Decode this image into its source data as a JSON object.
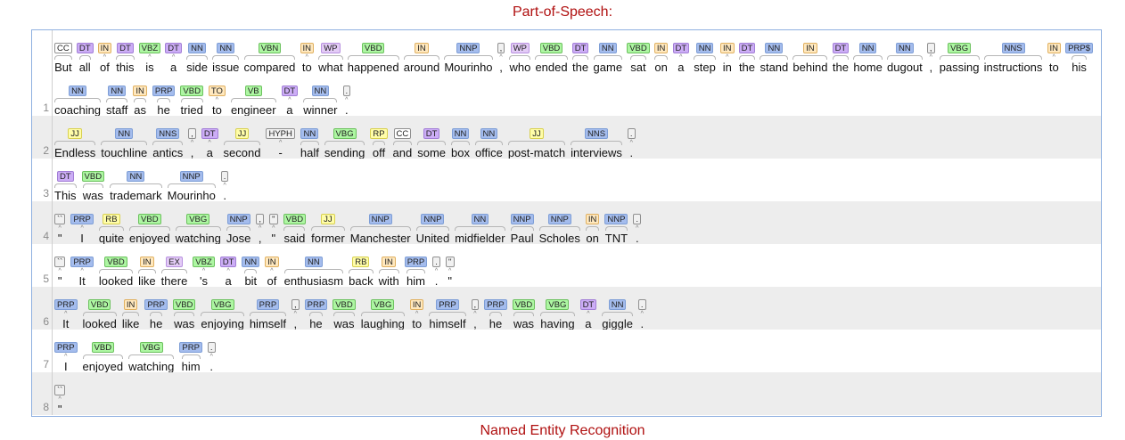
{
  "section_title": "Part-of-Speech:",
  "next_section_title": "Named Entity Recognition",
  "tag_colors": {
    "blue": {
      "bg": "#a4bced",
      "bd": "#7e9ed6"
    },
    "green": {
      "bg": "#adf6a2",
      "bd": "#6cc15e"
    },
    "purple": {
      "bg": "#ccadf6",
      "bd": "#a27ed6"
    },
    "orange": {
      "bg": "#ffe8be",
      "bd": "#e0b060"
    },
    "yellow": {
      "bg": "#fffda8",
      "bd": "#d8d050"
    },
    "pink": {
      "bg": "#e3cbf6",
      "bd": "#b891e0"
    },
    "white": {
      "bg": "#ffffff",
      "bd": "#909090"
    },
    "gray": {
      "bg": "#f1f1f1",
      "bd": "#909090"
    }
  },
  "sentences": [
    {
      "number": "1",
      "rows": [
        [
          [
            "But",
            "CC"
          ],
          [
            "all",
            "DT"
          ],
          [
            "of",
            "IN"
          ],
          [
            "this",
            "DT"
          ],
          [
            "is",
            "VBZ"
          ],
          [
            "a",
            "DT"
          ],
          [
            "side",
            "NN"
          ],
          [
            "issue",
            "NN"
          ],
          [
            "compared",
            "VBN"
          ],
          [
            "to",
            "IN"
          ],
          [
            "what",
            "WP"
          ],
          [
            "happened",
            "VBD"
          ],
          [
            "around",
            "IN"
          ],
          [
            "Mourinho",
            "NNP"
          ],
          [
            ",",
            ","
          ],
          [
            "who",
            "WP"
          ],
          [
            "ended",
            "VBD"
          ],
          [
            "the",
            "DT"
          ],
          [
            "game",
            "NN"
          ],
          [
            "sat",
            "VBD"
          ],
          [
            "on",
            "IN"
          ],
          [
            "a",
            "DT"
          ],
          [
            "step",
            "NN"
          ],
          [
            "in",
            "IN"
          ],
          [
            "the",
            "DT"
          ],
          [
            "stand",
            "NN"
          ],
          [
            "behind",
            "IN"
          ],
          [
            "the",
            "DT"
          ],
          [
            "home",
            "NN"
          ],
          [
            "dugout",
            "NN"
          ],
          [
            ",",
            ","
          ],
          [
            "passing",
            "VBG"
          ],
          [
            "instructions",
            "NNS"
          ],
          [
            "to",
            "IN"
          ],
          [
            "his",
            "PRP$"
          ]
        ],
        [
          [
            "coaching",
            "NN"
          ],
          [
            "staff",
            "NN"
          ],
          [
            "as",
            "IN"
          ],
          [
            "he",
            "PRP"
          ],
          [
            "tried",
            "VBD"
          ],
          [
            "to",
            "TO"
          ],
          [
            "engineer",
            "VB"
          ],
          [
            "a",
            "DT"
          ],
          [
            "winner",
            "NN"
          ],
          [
            ".",
            "."
          ]
        ]
      ]
    },
    {
      "number": "2",
      "rows": [
        [
          [
            "Endless",
            "JJ"
          ],
          [
            "touchline",
            "NN"
          ],
          [
            "antics",
            "NNS"
          ],
          [
            ",",
            ","
          ],
          [
            "a",
            "DT"
          ],
          [
            "second",
            "JJ"
          ],
          [
            "-",
            "HYPH"
          ],
          [
            "half",
            "NN"
          ],
          [
            "sending",
            "VBG"
          ],
          [
            "off",
            "RP"
          ],
          [
            "and",
            "CC"
          ],
          [
            "some",
            "DT"
          ],
          [
            "box",
            "NN"
          ],
          [
            "office",
            "NN"
          ],
          [
            "post-match",
            "JJ"
          ],
          [
            "interviews",
            "NNS"
          ],
          [
            ".",
            "."
          ]
        ]
      ]
    },
    {
      "number": "3",
      "rows": [
        [
          [
            "This",
            "DT"
          ],
          [
            "was",
            "VBD"
          ],
          [
            "trademark",
            "NN"
          ],
          [
            "Mourinho",
            "NNP"
          ],
          [
            ".",
            "."
          ]
        ]
      ]
    },
    {
      "number": "4",
      "rows": [
        [
          [
            "\"",
            "``"
          ],
          [
            "I",
            "PRP"
          ],
          [
            "quite",
            "RB"
          ],
          [
            "enjoyed",
            "VBD"
          ],
          [
            "watching",
            "VBG"
          ],
          [
            "Jose",
            "NNP"
          ],
          [
            ",",
            ","
          ],
          [
            "\"",
            "''"
          ],
          [
            "said",
            "VBD"
          ],
          [
            "former",
            "JJ"
          ],
          [
            "Manchester",
            "NNP"
          ],
          [
            "United",
            "NNP"
          ],
          [
            "midfielder",
            "NN"
          ],
          [
            "Paul",
            "NNP"
          ],
          [
            "Scholes",
            "NNP"
          ],
          [
            "on",
            "IN"
          ],
          [
            "TNT",
            "NNP"
          ],
          [
            ".",
            "."
          ]
        ]
      ]
    },
    {
      "number": "5",
      "rows": [
        [
          [
            "\"",
            "``"
          ],
          [
            "It",
            "PRP"
          ],
          [
            "looked",
            "VBD"
          ],
          [
            "like",
            "IN"
          ],
          [
            "there",
            "EX"
          ],
          [
            "'s",
            "VBZ"
          ],
          [
            "a",
            "DT"
          ],
          [
            "bit",
            "NN"
          ],
          [
            "of",
            "IN"
          ],
          [
            "enthusiasm",
            "NN"
          ],
          [
            "back",
            "RB"
          ],
          [
            "with",
            "IN"
          ],
          [
            "him",
            "PRP"
          ],
          [
            ".",
            "."
          ],
          [
            "\"",
            "''"
          ]
        ]
      ]
    },
    {
      "number": "6",
      "rows": [
        [
          [
            "It",
            "PRP"
          ],
          [
            "looked",
            "VBD"
          ],
          [
            "like",
            "IN"
          ],
          [
            "he",
            "PRP"
          ],
          [
            "was",
            "VBD"
          ],
          [
            "enjoying",
            "VBG"
          ],
          [
            "himself",
            "PRP"
          ],
          [
            ",",
            ","
          ],
          [
            "he",
            "PRP"
          ],
          [
            "was",
            "VBD"
          ],
          [
            "laughing",
            "VBG"
          ],
          [
            "to",
            "IN"
          ],
          [
            "himself",
            "PRP"
          ],
          [
            ",",
            ","
          ],
          [
            "he",
            "PRP"
          ],
          [
            "was",
            "VBD"
          ],
          [
            "having",
            "VBG"
          ],
          [
            "a",
            "DT"
          ],
          [
            "giggle",
            "NN"
          ],
          [
            ".",
            "."
          ]
        ]
      ]
    },
    {
      "number": "7",
      "rows": [
        [
          [
            "I",
            "PRP"
          ],
          [
            "enjoyed",
            "VBD"
          ],
          [
            "watching",
            "VBG"
          ],
          [
            "him",
            "PRP"
          ],
          [
            ".",
            "."
          ]
        ]
      ]
    },
    {
      "number": "8",
      "rows": [
        [
          [
            "\"",
            "``"
          ]
        ]
      ]
    }
  ]
}
